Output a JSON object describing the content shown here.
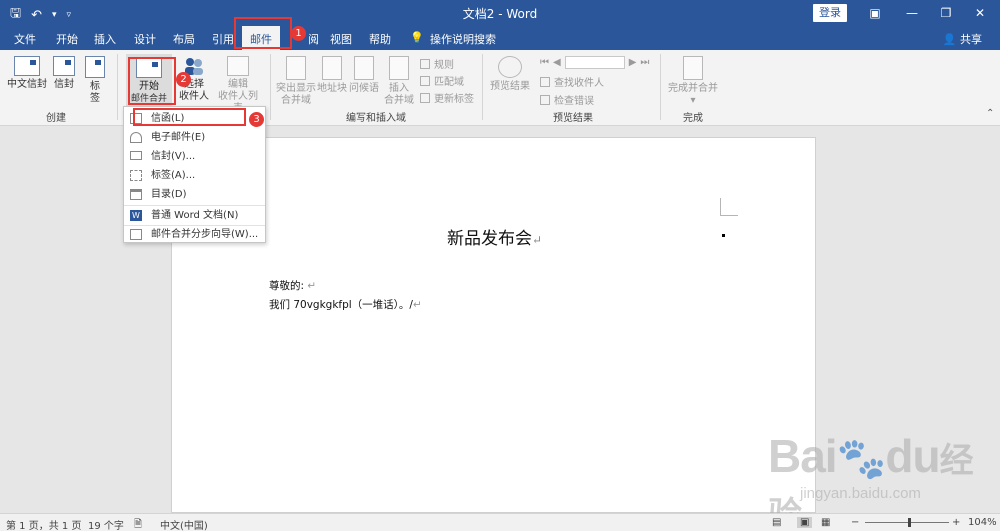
{
  "titlebar": {
    "doc_title": "文档2 - Word",
    "login_label": "登录"
  },
  "tabs": [
    {
      "label": "文件"
    },
    {
      "label": "开始"
    },
    {
      "label": "插入"
    },
    {
      "label": "设计"
    },
    {
      "label": "布局"
    },
    {
      "label": "引用"
    },
    {
      "label": "邮件"
    },
    {
      "label": "阅"
    },
    {
      "label": "视图"
    },
    {
      "label": "帮助"
    },
    {
      "label": "操作说明搜索"
    }
  ],
  "share_label": "共享",
  "ribbon": {
    "create": {
      "chinese_envelope": "中文信封",
      "envelope": "信封",
      "label_line1": "标",
      "label_line2": "签",
      "group": "创建"
    },
    "start_merge": {
      "start_line1": "开始",
      "start_line2": "邮件合并",
      "select_line1": "选择",
      "select_line2": "收件人",
      "edit_line1": "编辑",
      "edit_line2": "收件人列表"
    },
    "write_insert": {
      "highlight_line1": "突出显示",
      "highlight_line2": "合并域",
      "address_block": "地址块",
      "greeting": "问候语",
      "insert_line1": "插入",
      "insert_line2": "合并域",
      "rules": "规则",
      "match_fields": "匹配域",
      "update_labels": "更新标签",
      "group": "编写和插入域"
    },
    "preview": {
      "preview_results": "预览结果",
      "find_recipient": "查找收件人",
      "check_errors": "检查错误",
      "group": "预览结果"
    },
    "finish": {
      "finish_merge_line1": "完成并合并",
      "group": "完成"
    }
  },
  "dropdown": {
    "items": [
      {
        "label": "信函(L)"
      },
      {
        "label": "电子邮件(E)"
      },
      {
        "label": "信封(V)..."
      },
      {
        "label": "标签(A)..."
      },
      {
        "label": "目录(D)"
      },
      {
        "label": "普通 Word 文档(N)"
      },
      {
        "label": "邮件合并分步向导(W)..."
      }
    ]
  },
  "badges": [
    "1",
    "2",
    "3"
  ],
  "document": {
    "title": "新品发布会",
    "salutation": "尊敬的:",
    "body": "我们 70vgkgkfpl（一堆话）。/"
  },
  "statusbar": {
    "page": "第 1 页，共 1 页",
    "words": "19 个字",
    "language": "中文(中国)",
    "zoom": "104%"
  },
  "watermark": {
    "brand": "Bai",
    "brand2": "du",
    "cn": "经验",
    "url": "jingyan.baidu.com"
  },
  "colors": {
    "accent": "#2b579a",
    "highlight": "#e53935"
  }
}
